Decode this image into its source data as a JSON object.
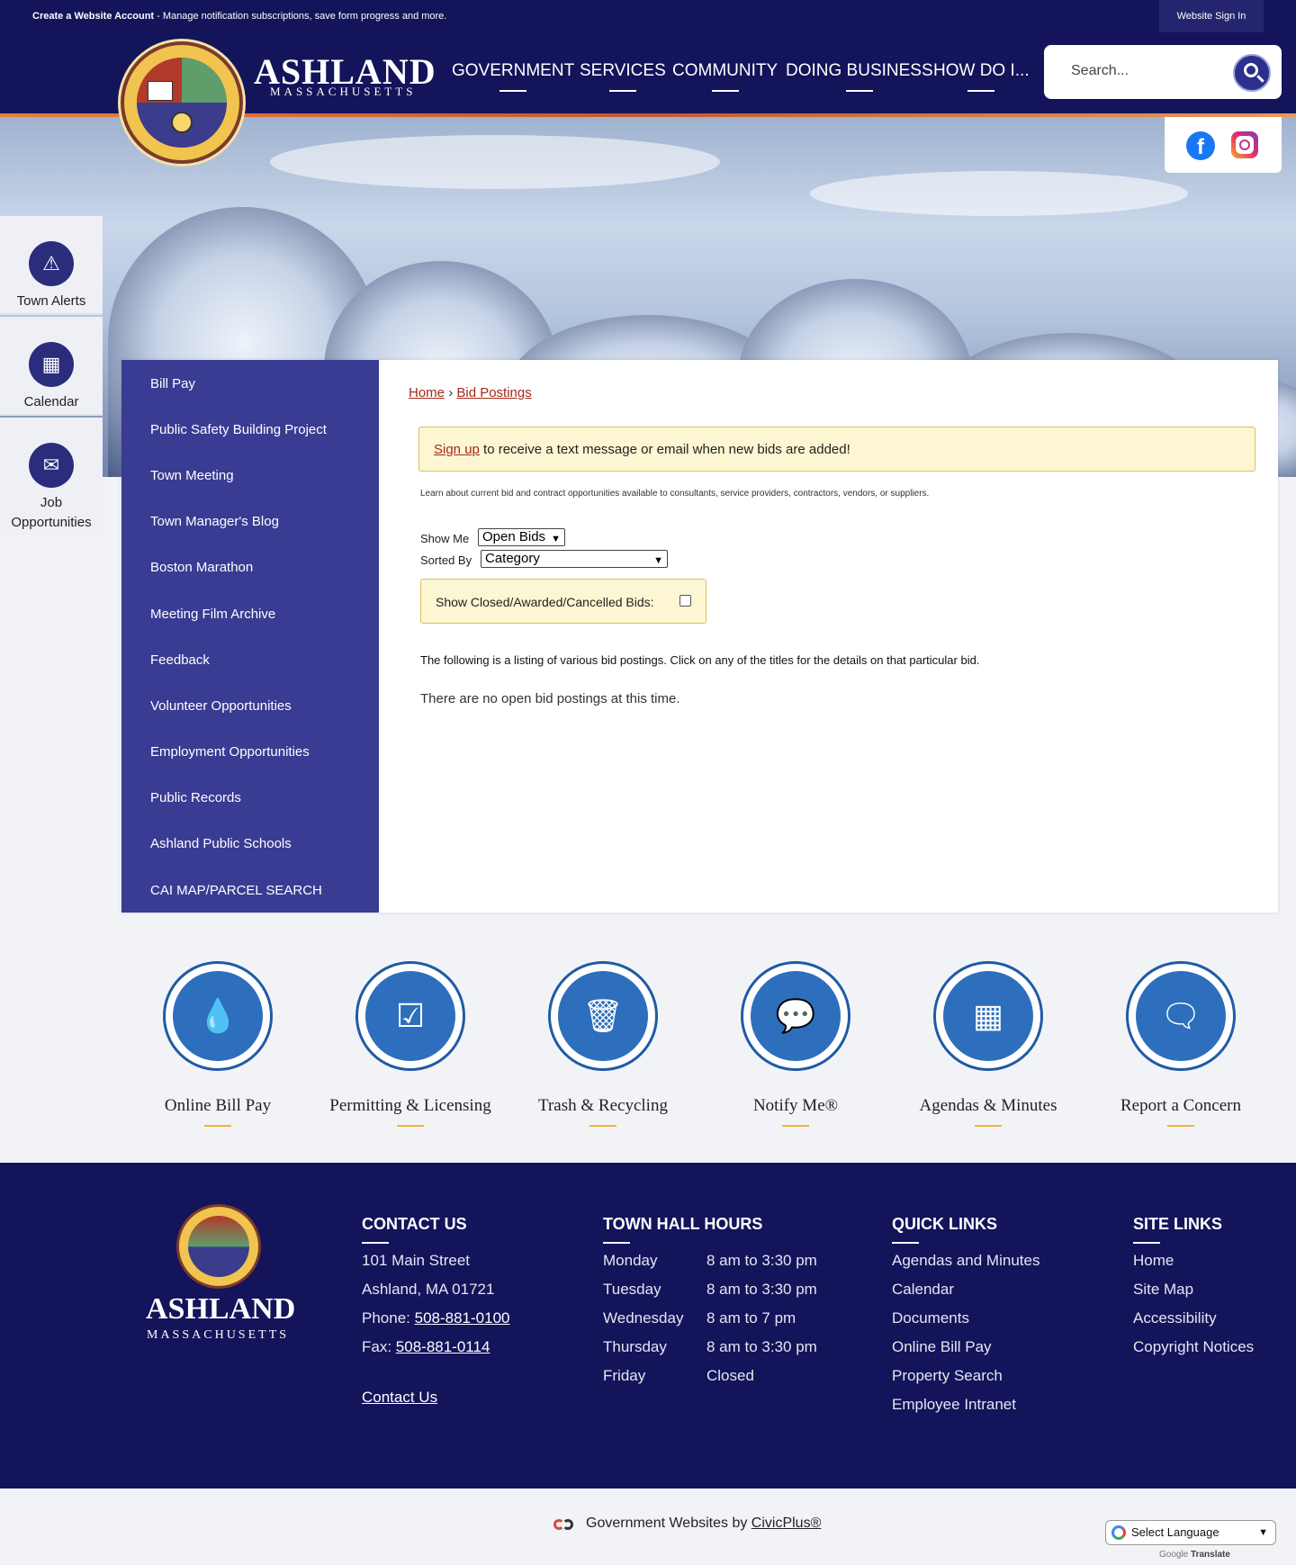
{
  "topbar": {
    "create_bold": "Create a Website Account",
    "create_rest": " - Manage notification subscriptions, save form progress and more.",
    "signin": "Website Sign In"
  },
  "header": {
    "logo_word": "ASHLAND",
    "logo_sub": "MASSACHUSETTS",
    "nav": [
      "GOVERNMENT",
      "SERVICES",
      "COMMUNITY",
      "DOING BUSINESS",
      "HOW DO I..."
    ],
    "search_placeholder": "Search..."
  },
  "rail": [
    {
      "label": "Town Alerts",
      "icon": "alert-icon"
    },
    {
      "label": "Calendar",
      "icon": "calendar-icon"
    },
    {
      "label": "Job Opportunities",
      "icon": "briefcase-icon"
    }
  ],
  "sidebar": {
    "items": [
      "Bill Pay",
      "Public Safety Building Project",
      "Town Meeting",
      "Town Manager's Blog",
      "Boston Marathon",
      "Meeting Film Archive",
      "Feedback",
      "Volunteer Opportunities",
      "Employment Opportunities",
      "Public Records",
      "Ashland Public Schools",
      "CAI MAP/PARCEL SEARCH"
    ]
  },
  "main": {
    "breadcrumb_home": "Home",
    "breadcrumb_sep": "›",
    "breadcrumb_current": "Bid Postings",
    "signup_link": "Sign up",
    "signup_rest": " to receive a text message or email when new bids are added!",
    "note": "Learn about current bid and contract opportunities available to consultants, service providers, contractors, vendors, or suppliers.",
    "show_me_label": "Show Me",
    "show_me_value": "Open Bids",
    "sorted_by_label": "Sorted By",
    "sorted_by_value": "Category",
    "closed_label": "Show Closed/Awarded/Cancelled Bids:",
    "listing_text": "The following is a listing of various bid postings. Click on any of the titles for the details on that particular bid.",
    "none_text": "There are no open bid postings at this time."
  },
  "quicklinks": [
    {
      "label": "Online Bill Pay",
      "icon": "water-drop-icon"
    },
    {
      "label": "Permitting & Licensing",
      "icon": "checklist-icon"
    },
    {
      "label": "Trash & Recycling",
      "icon": "trash-icon"
    },
    {
      "label": "Notify Me®",
      "icon": "chat-notify-icon"
    },
    {
      "label": "Agendas & Minutes",
      "icon": "calendar-icon"
    },
    {
      "label": "Report a Concern",
      "icon": "speech-bubbles-icon"
    }
  ],
  "footer": {
    "logo_word": "ASHLAND",
    "logo_sub": "MASSACHUSETTS",
    "contact_title": "CONTACT US",
    "address1": "101 Main Street",
    "address2": "Ashland, MA 01721",
    "phone_label": "Phone: ",
    "phone": "508-881-0100",
    "fax_label": "Fax: ",
    "fax": "508-881-0114",
    "contact_link": "Contact Us",
    "hours_title": "TOWN HALL HOURS",
    "hours": [
      {
        "day": "Monday",
        "time": "8 am to 3:30 pm"
      },
      {
        "day": "Tuesday",
        "time": "8 am to 3:30 pm"
      },
      {
        "day": "Wednesday",
        "time": "8 am to 7 pm"
      },
      {
        "day": "Thursday",
        "time": "8 am to 3:30 pm"
      },
      {
        "day": "Friday",
        "time": "Closed"
      }
    ],
    "quick_title": "QUICK LINKS",
    "quick": [
      "Agendas and Minutes",
      "Calendar",
      "Documents",
      "Online Bill Pay",
      "Property Search",
      "Employee Intranet"
    ],
    "site_title": "SITE LINKS",
    "site": [
      "Home",
      "Site Map",
      "Accessibility",
      "Copyright Notices"
    ]
  },
  "bottom": {
    "civic_text": "Government Websites by ",
    "civic_link": "CivicPlus®",
    "language": "Select Language",
    "powered_prefix": "Google ",
    "powered_word": "Translate"
  },
  "colors": {
    "navy": "#13145a",
    "sidebar": "#3a3b92",
    "accent_link": "#a42a1a",
    "icon_blue": "#2d6fbd",
    "notice_bg": "#fdf6d3"
  }
}
